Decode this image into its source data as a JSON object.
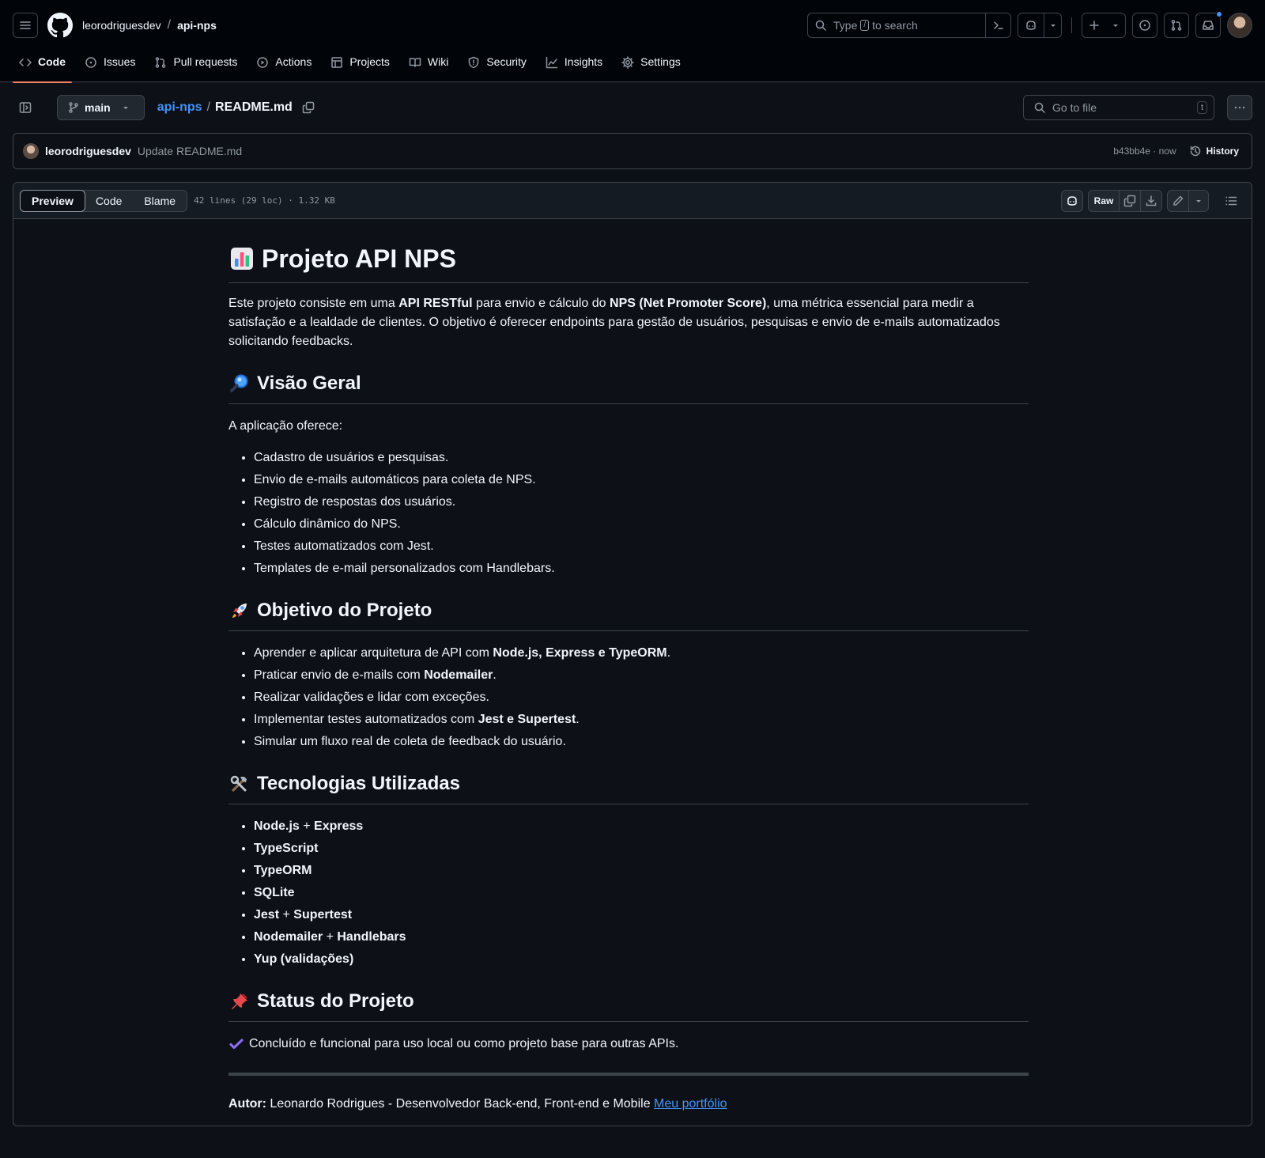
{
  "header": {
    "owner": "leorodriguesdev",
    "repo": "api-nps",
    "search_prefix": "Type",
    "search_key": "/",
    "search_suffix": "to search"
  },
  "nav": [
    {
      "label": "Code",
      "icon": "code-icon",
      "active": true
    },
    {
      "label": "Issues",
      "icon": "issue-icon"
    },
    {
      "label": "Pull requests",
      "icon": "pull-request-icon"
    },
    {
      "label": "Actions",
      "icon": "play-icon"
    },
    {
      "label": "Projects",
      "icon": "table-icon"
    },
    {
      "label": "Wiki",
      "icon": "book-icon"
    },
    {
      "label": "Security",
      "icon": "shield-icon"
    },
    {
      "label": "Insights",
      "icon": "graph-icon"
    },
    {
      "label": "Settings",
      "icon": "gear-icon"
    }
  ],
  "file_header": {
    "branch": "main",
    "repo_link": "api-nps",
    "file_name": "README.md",
    "goto_placeholder": "Go to file",
    "goto_key": "t"
  },
  "commit": {
    "author": "leorodriguesdev",
    "message": "Update README.md",
    "sha_time": "b43bb4e · now",
    "history_label": "History"
  },
  "file_toolbar": {
    "tabs": [
      "Preview",
      "Code",
      "Blame"
    ],
    "active_tab": "Preview",
    "info": "42 lines (29 loc) · 1.32 KB",
    "raw_label": "Raw"
  },
  "readme": {
    "title": "Projeto API NPS",
    "title_emoji": "bar-chart-icon",
    "intro": {
      "t1": "Este projeto consiste em uma ",
      "b1": "API RESTful",
      "t2": " para envio e cálculo do ",
      "b2": "NPS (Net Promoter Score)",
      "t3": ", uma métrica essencial para medir a satisfação e a lealdade de clientes. O objetivo é oferecer endpoints para gestão de usuários, pesquisas e envio de e-mails automatizados solicitando feedbacks."
    },
    "overview": {
      "heading": "Visão Geral",
      "lead": "A aplicação oferece:",
      "items": [
        "Cadastro de usuários e pesquisas.",
        "Envio de e-mails automáticos para coleta de NPS.",
        "Registro de respostas dos usuários.",
        "Cálculo dinâmico do NPS.",
        "Testes automatizados com Jest.",
        "Templates de e-mail personalizados com Handlebars."
      ]
    },
    "goals": {
      "heading": "Objetivo do Projeto",
      "items": [
        {
          "pre": "Aprender e aplicar arquitetura de API com ",
          "bold": "Node.js, Express e TypeORM",
          "post": "."
        },
        {
          "pre": "Praticar envio de e-mails com ",
          "bold": "Nodemailer",
          "post": "."
        },
        {
          "pre": "Realizar validações e lidar com exceções.",
          "bold": "",
          "post": ""
        },
        {
          "pre": "Implementar testes automatizados com ",
          "bold": "Jest e Supertest",
          "post": "."
        },
        {
          "pre": "Simular um fluxo real de coleta de feedback do usuário.",
          "bold": "",
          "post": ""
        }
      ]
    },
    "tech": {
      "heading": "Tecnologias Utilizadas",
      "items": [
        {
          "a": "Node.js",
          "sep": " + ",
          "b": "Express"
        },
        {
          "a": "TypeScript",
          "sep": "",
          "b": ""
        },
        {
          "a": "TypeORM",
          "sep": "",
          "b": ""
        },
        {
          "a": "SQLite",
          "sep": "",
          "b": ""
        },
        {
          "a": "Jest",
          "sep": " + ",
          "b": "Supertest"
        },
        {
          "a": "Nodemailer",
          "sep": " + ",
          "b": "Handlebars"
        },
        {
          "a": "Yup",
          "sep": " (validações)",
          "b": ""
        }
      ]
    },
    "status": {
      "heading": "Status do Projeto",
      "text": "Concluído e funcional para uso local ou como projeto base para outras APIs."
    },
    "author": {
      "label": "Autor:",
      "text": " Leonardo Rodrigues - Desenvolvedor Back-end, Front-end e Mobile ",
      "link": "Meu portfólio"
    }
  },
  "colors": {
    "bg": "#0d1117",
    "header_bg": "#010409",
    "border": "#3d444d",
    "link": "#4493f8",
    "accent_underline": "#f78166"
  }
}
